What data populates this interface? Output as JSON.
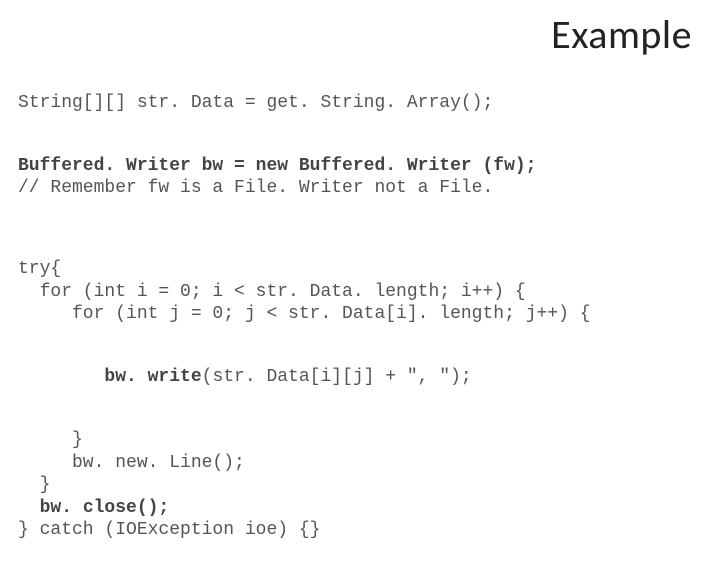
{
  "title": "Example",
  "code": {
    "line1": "String[][] str. Data = get. String. Array();",
    "line2_bold": "Buffered. Writer bw = new Buffered. Writer (fw);",
    "line3": "// Remember fw is a File. Writer not a File.",
    "line4": "try{",
    "line5": "  for (int i = 0; i < str. Data. length; i++) {",
    "line6": "     for (int j = 0; j < str. Data[i]. length; j++) {",
    "line7_prefix": "        ",
    "line7_bold": "bw. write",
    "line7_suffix": "(str. Data[i][j] + \", \");",
    "line8": "     }",
    "line9": "     bw. new. Line();",
    "line10": "  }",
    "line11_prefix": "  ",
    "line11_bold": "bw. close();",
    "line12": "} catch (IOException ioe) {}"
  }
}
